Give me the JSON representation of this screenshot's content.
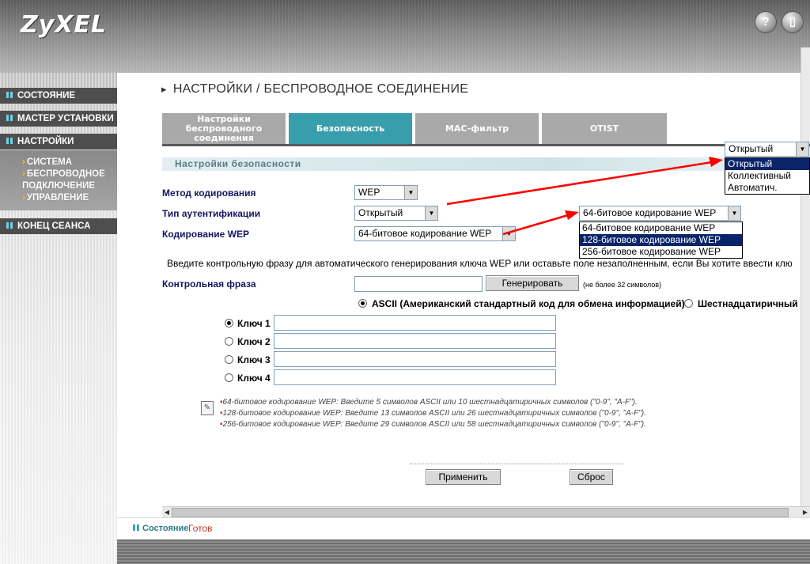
{
  "brand": {
    "logo": "ZyXEL"
  },
  "header_buttons": {
    "help": "?",
    "logout": "▯"
  },
  "sidebar": {
    "items": [
      {
        "label": "СОСТОЯНИЕ"
      },
      {
        "label": "МАСТЕР УСТАНОВКИ"
      },
      {
        "label": "НАСТРОЙКИ"
      },
      {
        "label": "КОНЕЦ СЕАНСА"
      }
    ],
    "sub_items": [
      {
        "label": "СИСТЕМА"
      },
      {
        "label": "БЕСПРОВОДНОЕ"
      },
      {
        "label": "ПОДКЛЮЧЕНИЕ"
      },
      {
        "label": "УПРАВЛЕНИЕ"
      }
    ]
  },
  "page": {
    "title": "НАСТРОЙКИ / БЕСПРОВОДНОЕ СОЕДИНЕНИЕ"
  },
  "tabs": [
    {
      "line1": "Настройки",
      "line2": "беспроводного",
      "line3": "соединения"
    },
    {
      "label": "Безопасность"
    },
    {
      "label": "MAC-фильтр"
    },
    {
      "label": "OTIST"
    }
  ],
  "section": {
    "title": "Настройки безопасности"
  },
  "form": {
    "encryption_method": {
      "label": "Метод кодирования",
      "value": "WEP"
    },
    "auth_type": {
      "label": "Тип аутентификации",
      "value": "Открытый",
      "dropdown_value": "Открытый",
      "options": [
        "Открытый",
        "Коллективный",
        "Автоматич."
      ]
    },
    "wep_encoding": {
      "label": "Кодирование WEP",
      "value": "64-битовое кодирование WEP",
      "dropdown_value": "64-битовое кодирование WEP",
      "options": [
        "64-битовое кодирование WEP",
        "128-битовое кодирование WEP",
        "256-битовое кодирование WEP"
      ]
    },
    "passphrase_intro": "Введите контрольную фразу для автоматического генерирования ключа WEP или оставьте поле незаполненным, если Вы хотите ввести клю",
    "passphrase": {
      "label": "Контрольная фраза",
      "value": "",
      "hint": "(не более 32 символов)"
    },
    "generate_button": "Генерировать",
    "format_ascii": "ASCII (Американский стандартный код для обмена информацией)",
    "format_hex": "Шестнадцатиричный",
    "keys": [
      {
        "label": "Ключ 1",
        "value": ""
      },
      {
        "label": "Ключ 2",
        "value": ""
      },
      {
        "label": "Ключ 3",
        "value": ""
      },
      {
        "label": "Ключ 4",
        "value": ""
      }
    ],
    "notes": [
      "64-битовое кодирование WEP: Введите 5 символов ASCII или 10 шестнадцатиричных символов (\"0-9\", \"A-F\").",
      "128-битовое кодирование WEP: Введите 13 символов ASCII или 26 шестнадцатиричных символов (\"0-9\", \"A-F\").",
      "256-битовое кодирование WEP: Введите 29 символов ASCII или 58 шестнадцатиричных символов (\"0-9\", \"A-F\")."
    ],
    "apply_button": "Применить",
    "reset_button": "Сброс"
  },
  "status": {
    "label": "Состояние",
    "value": "Готов"
  },
  "colors": {
    "accent": "#399eab",
    "tab": "#a9a9a9",
    "nav": "#4e4e4e",
    "annotation": "#ff0000"
  },
  "icons": {
    "note": "note-icon",
    "nav_bullet": "grid-icon",
    "sub_bullet": "arrow-right-icon"
  }
}
